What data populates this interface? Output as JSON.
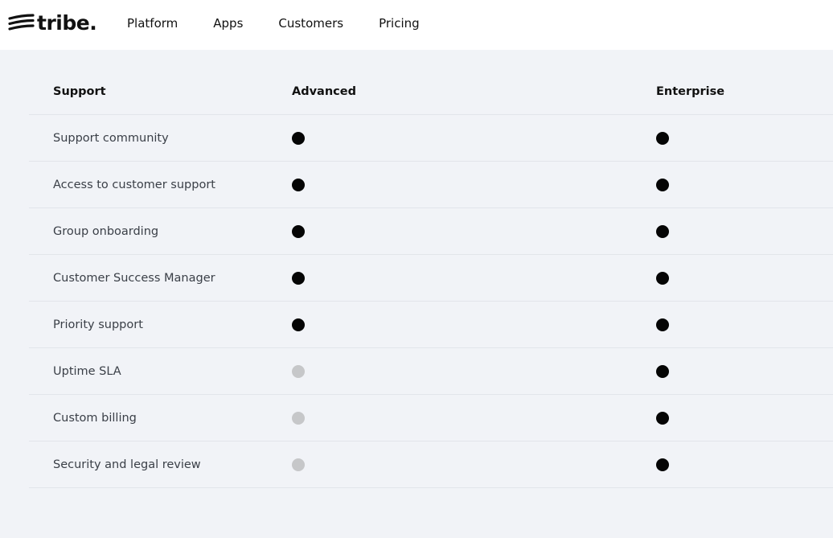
{
  "brand": {
    "name": "tribe.",
    "logo_icon": "stacked-lines-icon"
  },
  "nav": {
    "items": [
      {
        "label": "Platform"
      },
      {
        "label": "Apps"
      },
      {
        "label": "Customers"
      },
      {
        "label": "Pricing"
      }
    ]
  },
  "colors": {
    "included": "#050505",
    "not_included": "#c6c7c9",
    "background": "#f1f3f7"
  },
  "table": {
    "headers": {
      "feature": "Support",
      "plan_a": "Advanced",
      "plan_b": "Enterprise"
    },
    "rows": [
      {
        "feature": "Support community",
        "advanced": true,
        "enterprise": true
      },
      {
        "feature": "Access to customer support",
        "advanced": true,
        "enterprise": true
      },
      {
        "feature": "Group onboarding",
        "advanced": true,
        "enterprise": true
      },
      {
        "feature": "Customer Success Manager",
        "advanced": true,
        "enterprise": true
      },
      {
        "feature": "Priority support",
        "advanced": true,
        "enterprise": true
      },
      {
        "feature": "Uptime SLA",
        "advanced": false,
        "enterprise": true
      },
      {
        "feature": "Custom billing",
        "advanced": false,
        "enterprise": true
      },
      {
        "feature": "Security and legal review",
        "advanced": false,
        "enterprise": true
      }
    ]
  }
}
